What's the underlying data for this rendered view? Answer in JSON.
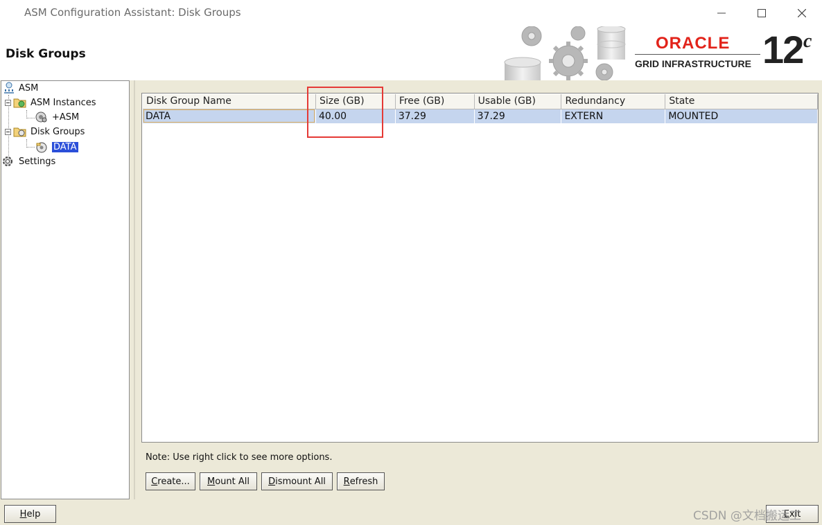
{
  "window": {
    "title": "ASM Configuration Assistant: Disk Groups",
    "minimize_icon": "minimize-icon",
    "maximize_icon": "maximize-icon",
    "close_icon": "close-icon"
  },
  "header": {
    "page_title": "Disk Groups",
    "logo_text": "ORACLE",
    "product_line": "GRID INFRASTRUCTURE",
    "version": "12",
    "version_suffix": "c",
    "brand_color": "#e2231a"
  },
  "tree": {
    "items": [
      {
        "label": "ASM",
        "icon": "asm-node-icon"
      },
      {
        "label": "ASM Instances",
        "icon": "instances-folder-icon"
      },
      {
        "label": "+ASM",
        "icon": "instance-icon"
      },
      {
        "label": "Disk Groups",
        "icon": "diskgroups-folder-icon"
      },
      {
        "label": "DATA",
        "icon": "diskgroup-icon",
        "selected": true
      },
      {
        "label": "Settings",
        "icon": "gear-icon"
      }
    ],
    "selection_color": "#2b4fd9"
  },
  "table": {
    "columns": [
      "Disk Group Name",
      "Size (GB)",
      "Free (GB)",
      "Usable (GB)",
      "Redundancy",
      "State"
    ],
    "rows": [
      [
        "DATA",
        "40.00",
        "37.29",
        "37.29",
        "EXTERN",
        "MOUNTED"
      ]
    ],
    "selected_row_color": "#c5d5ee"
  },
  "note": "Note: Use right click to see more options.",
  "buttons": {
    "create": {
      "mnemonic": "C",
      "rest": "reate..."
    },
    "mount_all": {
      "mnemonic": "M",
      "rest": "ount All"
    },
    "dismount_all": {
      "mnemonic": "D",
      "rest": "ismount All"
    },
    "refresh": {
      "mnemonic": "R",
      "rest": "efresh"
    },
    "help": {
      "mnemonic": "H",
      "rest": "elp"
    },
    "exit": {
      "mnemonic": "E",
      "rest": "xit"
    }
  },
  "annotation": {
    "color": "#e53935"
  },
  "watermark": "CSDN @文档搬运工"
}
